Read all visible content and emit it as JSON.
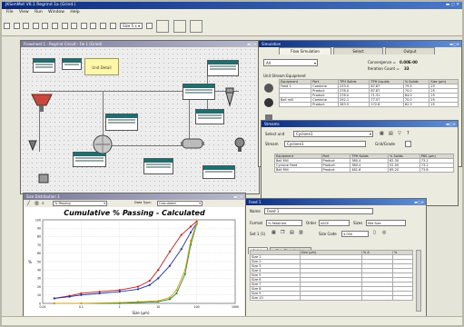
{
  "app": {
    "title": "JKSimMet V6.1 Regrind 1a (Grind.)",
    "window_controls": "▬ ▢ ✕"
  },
  "menu": [
    "File",
    "View",
    "Run",
    "Window",
    "Help"
  ],
  "toolbar": {
    "selector_value": "Size 5 x ▾"
  },
  "flowsheet": {
    "title": "Flowsheet 1 - Regrind Circuit - Fw 1 (Grind)",
    "unit_detail_label": "Unit Detail"
  },
  "simulation": {
    "title": "Simulation",
    "tabs": [
      "Flow Simulation",
      "Select",
      "Output"
    ],
    "mode_value": "All",
    "convergence_label": "Convergence =",
    "convergence_value": "0.00E-00",
    "iteration_label": "Iteration Count =",
    "iteration_value": "33",
    "grid_caption": "Unit Stream Equipment",
    "columns": [
      "Equipment",
      "Port",
      "TPH Solids",
      "TPH Liquids",
      "% Solids",
      "Size (µm)"
    ],
    "rows": [
      [
        "Feed 1",
        "Combine",
        "233.0",
        "87.87",
        "79.5",
        "25"
      ],
      [
        "",
        "Product",
        "278.0",
        "87.87",
        "70.0",
        "25"
      ],
      [
        "",
        "Product",
        "278.0",
        "71.31",
        "84.0",
        "25"
      ],
      [
        "Ball mill",
        "Combine",
        "292.1",
        "77.07",
        "70.0",
        "25"
      ],
      [
        "",
        "Product",
        "283.5",
        "172.8",
        "62.3",
        "25"
      ]
    ]
  },
  "streams": {
    "title": "Streams",
    "select_label": "Select unit",
    "select_value": "Cyclone1",
    "stream_label": "Stream",
    "stream_value": "Cyclone1",
    "grid_label": "Grid/Grade",
    "columns": [
      "Equipment",
      "Port",
      "TPH Solids",
      "% Solids",
      "P80 (µm)"
    ],
    "rows": [
      [
        "Ball Mill",
        "Product",
        "380.4",
        "62.30",
        "73.2"
      ],
      [
        "Cyclone Feed",
        "Product",
        "380.4",
        "52.00",
        "73.2"
      ],
      [
        "Ball Mill",
        "Product",
        "481.6",
        "65.20",
        "73.8"
      ]
    ]
  },
  "chart_window": {
    "title": "Size Distribution 1",
    "passing_value": "% Passing",
    "data_type_label": "Data Type:",
    "data_type_value": "Calculated"
  },
  "chart_data": {
    "type": "line",
    "title": "Cumulative % Passing - Calculated",
    "xlabel": "Size (µm)",
    "ylabel": "%",
    "xscale": "log",
    "xlim": [
      0.01,
      1000
    ],
    "ylim": [
      0,
      100
    ],
    "x_ticks": [
      "0.01",
      "0.1",
      "1",
      "10",
      "100",
      "1000"
    ],
    "y_ticks": [
      "0",
      "10",
      "20",
      "30",
      "40",
      "50",
      "60",
      "70",
      "80",
      "90",
      "100"
    ],
    "grid": true,
    "series": [
      {
        "color": "#c02020",
        "x": [
          0.02,
          0.05,
          0.1,
          0.3,
          1,
          3,
          6,
          10,
          20,
          40,
          70,
          100
        ],
        "y": [
          6,
          9,
          12,
          14,
          16,
          20,
          27,
          40,
          62,
          82,
          92,
          98
        ]
      },
      {
        "color": "#2030a0",
        "x": [
          0.02,
          0.05,
          0.1,
          0.3,
          1,
          3,
          6,
          10,
          20,
          40,
          70,
          100
        ],
        "y": [
          6,
          8,
          10,
          12,
          14,
          17,
          22,
          30,
          45,
          65,
          85,
          96
        ]
      },
      {
        "color": "#2a8a2a",
        "x": [
          0.02,
          0.1,
          1,
          3,
          10,
          20,
          30,
          50,
          70,
          100
        ],
        "y": [
          0,
          0,
          0,
          1,
          2,
          5,
          12,
          35,
          70,
          95
        ]
      },
      {
        "color": "#d0a020",
        "x": [
          0.02,
          0.1,
          1,
          3,
          10,
          20,
          30,
          50,
          70,
          100
        ],
        "y": [
          0,
          0,
          1,
          2,
          3,
          7,
          16,
          40,
          75,
          96
        ]
      }
    ]
  },
  "stream_window": {
    "title": "Feed 1",
    "name_label": "Name",
    "name_value": "Feed 1",
    "format_label": "Format",
    "format_value": "% Retained",
    "order_label": "Order",
    "order_value": "ASCE",
    "sizes_label": "Sizes",
    "sizes_value": "Mid Size",
    "set_label": "Set 1 (1)",
    "sg_label": "Size Code",
    "sg_value": "4.000",
    "tabs": [
      "Solids",
      "Size Distribution"
    ],
    "columns": [
      "",
      "Size (µm)",
      "% A",
      "%"
    ],
    "rows": [
      [
        "Size 1",
        "",
        "",
        ""
      ],
      [
        "Size 2",
        "",
        "",
        ""
      ],
      [
        "Size 3",
        "",
        "",
        ""
      ],
      [
        "Size 4",
        "",
        "",
        ""
      ],
      [
        "Size 5",
        "",
        "",
        ""
      ],
      [
        "Size 6",
        "",
        "",
        ""
      ],
      [
        "Size 7",
        "",
        "",
        ""
      ],
      [
        "Size 8",
        "",
        "",
        ""
      ],
      [
        "Size 9",
        "",
        "",
        ""
      ],
      [
        "Size 10",
        "",
        "",
        ""
      ]
    ]
  }
}
